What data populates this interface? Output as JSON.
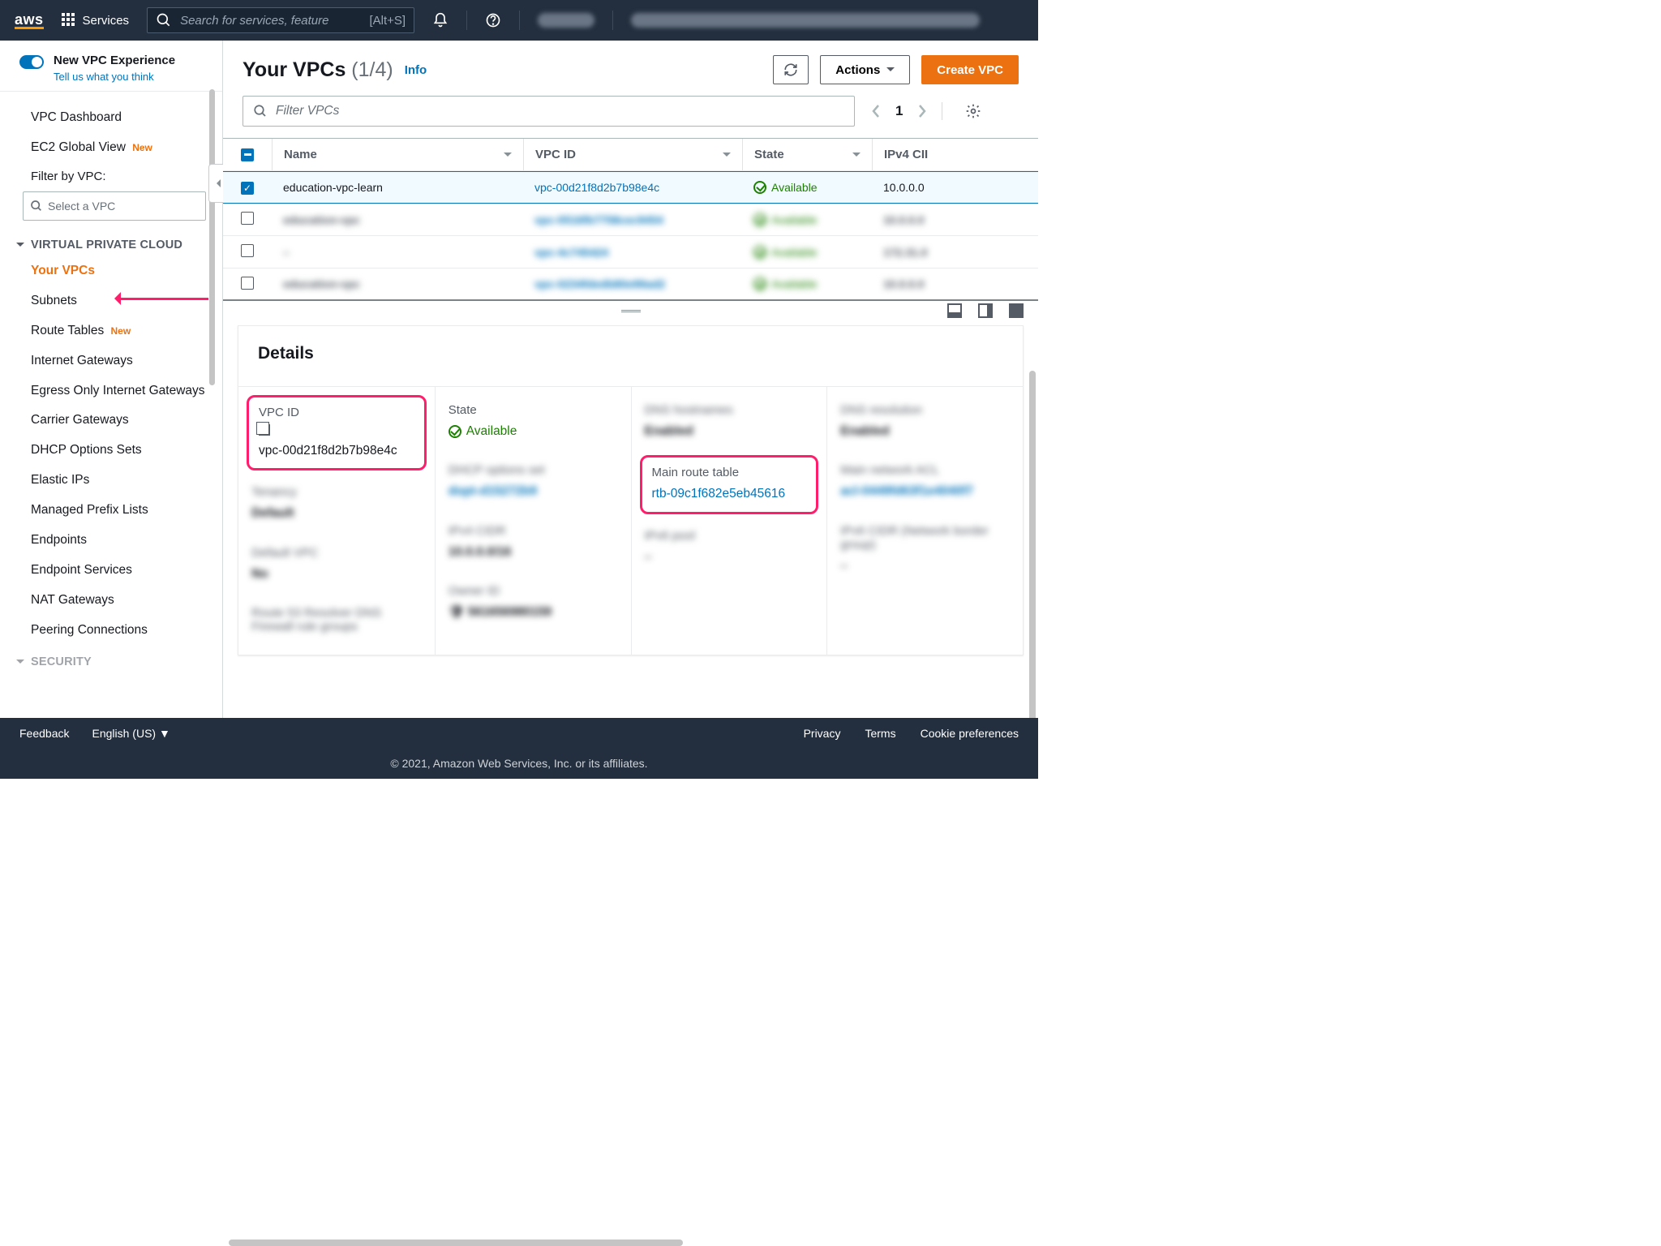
{
  "topnav": {
    "logo": "aws",
    "services": "Services",
    "search_placeholder": "Search for services, feature",
    "search_shortcut": "[Alt+S]"
  },
  "sidebar": {
    "new_experience_title": "New VPC Experience",
    "new_experience_sub": "Tell us what you think",
    "dashboard": "VPC Dashboard",
    "ec2_global": "EC2 Global View",
    "new_badge": "New",
    "filter_label": "Filter by VPC:",
    "filter_placeholder": "Select a VPC",
    "section_vpc": "VIRTUAL PRIVATE CLOUD",
    "items": {
      "your_vpcs": "Your VPCs",
      "subnets": "Subnets",
      "route_tables": "Route Tables",
      "internet_gateways": "Internet Gateways",
      "egress": "Egress Only Internet Gateways",
      "carrier": "Carrier Gateways",
      "dhcp": "DHCP Options Sets",
      "elastic": "Elastic IPs",
      "prefix": "Managed Prefix Lists",
      "endpoints": "Endpoints",
      "endpoint_services": "Endpoint Services",
      "nat": "NAT Gateways",
      "peering": "Peering Connections"
    },
    "section_security": "SECURITY"
  },
  "page": {
    "title": "Your VPCs",
    "count": "(1/4)",
    "info": "Info",
    "actions": "Actions",
    "create": "Create VPC",
    "filter_placeholder": "Filter VPCs",
    "page_num": "1"
  },
  "table": {
    "headers": {
      "name": "Name",
      "vpc_id": "VPC ID",
      "state": "State",
      "cidr": "IPv4 CII"
    },
    "rows": [
      {
        "name": "education-vpc-learn",
        "vpc_id": "vpc-00d21f8d2b7b98e4c",
        "state": "Available",
        "cidr": "10.0.0.0",
        "selected": true
      },
      {
        "name": "education-vpc",
        "vpc_id": "vpc-0516fb7758cec9454",
        "state": "Available",
        "cidr": "10.0.0.0",
        "selected": false
      },
      {
        "name": "–",
        "vpc_id": "vpc-4c745424",
        "state": "Available",
        "cidr": "172.31.0",
        "selected": false
      },
      {
        "name": "education-vpc",
        "vpc_id": "vpc-0234fdedb80e99ad2",
        "state": "Available",
        "cidr": "10.0.0.0",
        "selected": false
      }
    ]
  },
  "details": {
    "heading": "Details",
    "vpc_id_label": "VPC ID",
    "vpc_id_value": "vpc-00d21f8d2b7b98e4c",
    "state_label": "State",
    "state_value": "Available",
    "dns_hostnames_label": "DNS hostnames",
    "dns_hostnames_value": "Enabled",
    "dns_resolution_label": "DNS resolution",
    "dns_resolution_value": "Enabled",
    "tenancy_label": "Tenancy",
    "tenancy_value": "Default",
    "dhcp_label": "DHCP options set",
    "dhcp_value": "dopt-d15272b9",
    "main_rt_label": "Main route table",
    "main_rt_value": "rtb-09c1f682e5eb45616",
    "main_acl_label": "Main network ACL",
    "main_acl_value": "acl-0449fd63f1e4040f7",
    "default_vpc_label": "Default VPC",
    "default_vpc_value": "No",
    "ipv4_cidr_label": "IPv4 CIDR",
    "ipv4_cidr_value": "10.0.0.0/16",
    "ipv6_pool_label": "IPv6 pool",
    "ipv6_pool_value": "–",
    "ipv6_cidr_label": "IPv6 CIDR (Network border group)",
    "ipv6_cidr_value": "–",
    "owner_label": "Owner ID",
    "owner_value": "561656980159",
    "r53_label": "Route 53 Resolver DNS Firewall rule groups"
  },
  "footer": {
    "feedback": "Feedback",
    "lang": "English (US)",
    "privacy": "Privacy",
    "terms": "Terms",
    "cookies": "Cookie preferences",
    "copyright": "© 2021, Amazon Web Services, Inc. or its affiliates."
  }
}
